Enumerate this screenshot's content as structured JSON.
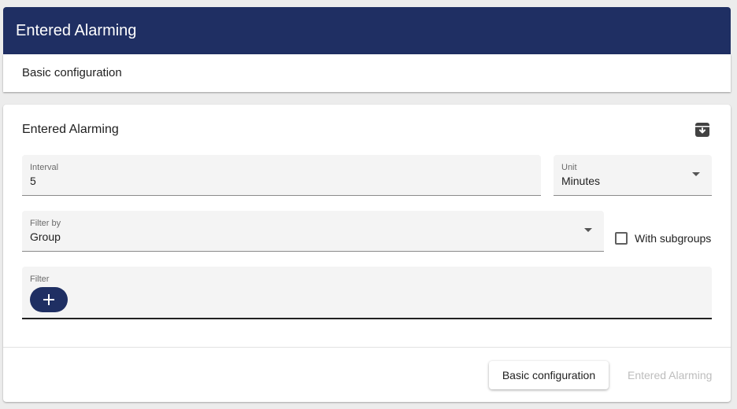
{
  "header": {
    "title": "Entered Alarming"
  },
  "top_card": {
    "label": "Basic configuration"
  },
  "section": {
    "title": "Entered Alarming",
    "archive_icon": "archive-download-icon"
  },
  "fields": {
    "interval": {
      "label": "Interval",
      "value": "5"
    },
    "unit": {
      "label": "Unit",
      "value": "Minutes"
    },
    "filter_by": {
      "label": "Filter by",
      "value": "Group"
    },
    "with_subgroups": {
      "label": "With subgroups",
      "checked": false
    },
    "filter": {
      "label": "Filter",
      "add_icon": "plus-icon"
    }
  },
  "footer": {
    "basic_button": "Basic configuration",
    "entered_button": "Entered Alarming"
  },
  "colors": {
    "primary": "#1f2f63",
    "field_bg": "#f4f4f4",
    "disabled_text": "#bdbdbd"
  }
}
